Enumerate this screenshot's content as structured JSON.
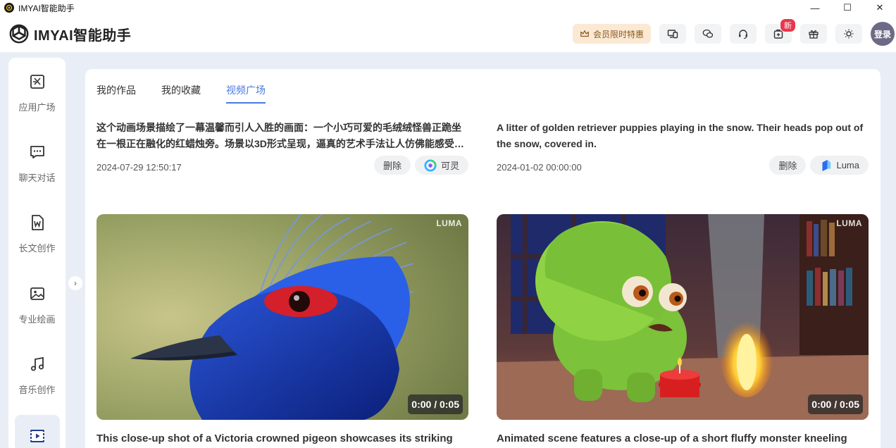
{
  "window": {
    "title": "IMYAI智能助手",
    "minimize": "—",
    "maximize": "☐",
    "close": "✕"
  },
  "header": {
    "logo_text": "IMYAI智能助手",
    "vip_label": "会员限时特惠",
    "new_badge": "新",
    "login_label": "登录",
    "icons": [
      "devices-icon",
      "wechat-icon",
      "headset-icon",
      "app-store-icon",
      "gift-icon",
      "theme-toggle-icon"
    ]
  },
  "sidebar": {
    "items": [
      {
        "label": "应用广场",
        "icon": "app-square-icon"
      },
      {
        "label": "聊天对话",
        "icon": "chat-icon"
      },
      {
        "label": "长文创作",
        "icon": "document-icon"
      },
      {
        "label": "专业绘画",
        "icon": "image-icon"
      },
      {
        "label": "音乐创作",
        "icon": "music-icon"
      },
      {
        "label": "",
        "icon": "video-icon"
      }
    ],
    "collapse_icon": "›"
  },
  "tabs": [
    {
      "label": "我的作品",
      "active": false
    },
    {
      "label": "我的收藏",
      "active": false
    },
    {
      "label": "视频广场",
      "active": true
    }
  ],
  "cards": [
    {
      "description": "这个动画场景描绘了一幕温馨而引人入胜的画面：一个小巧可爱的毛绒绒怪兽正跪坐在一根正在融化的红蜡烛旁。场景以3D形式呈现，逼真的艺术手法让人仿佛能感受到那柔软的毛发和温暖的烛光。",
      "date": "2024-07-29 12:50:17",
      "delete_label": "删除",
      "provider": "可灵",
      "provider_icon": "kling-icon"
    },
    {
      "description": "A litter of golden retriever puppies playing in the snow. Their heads pop out of the snow, covered in.",
      "date": "2024-01-02 00:00:00",
      "delete_label": "删除",
      "provider": "Luma",
      "provider_icon": "luma-icon"
    }
  ],
  "videos": [
    {
      "watermark": "LUMA",
      "duration": "0:00 / 0:05",
      "caption": "This close-up shot of a Victoria crowned pigeon showcases its striking"
    },
    {
      "watermark": "LUMA",
      "duration": "0:00 / 0:05",
      "caption": "Animated scene features a close-up of a short fluffy monster kneeling"
    }
  ],
  "colors": {
    "accent": "#4a7ae0",
    "vip_bg": "#fbe9d4",
    "badge": "#e8374d",
    "app_bg": "#e9eef6"
  }
}
